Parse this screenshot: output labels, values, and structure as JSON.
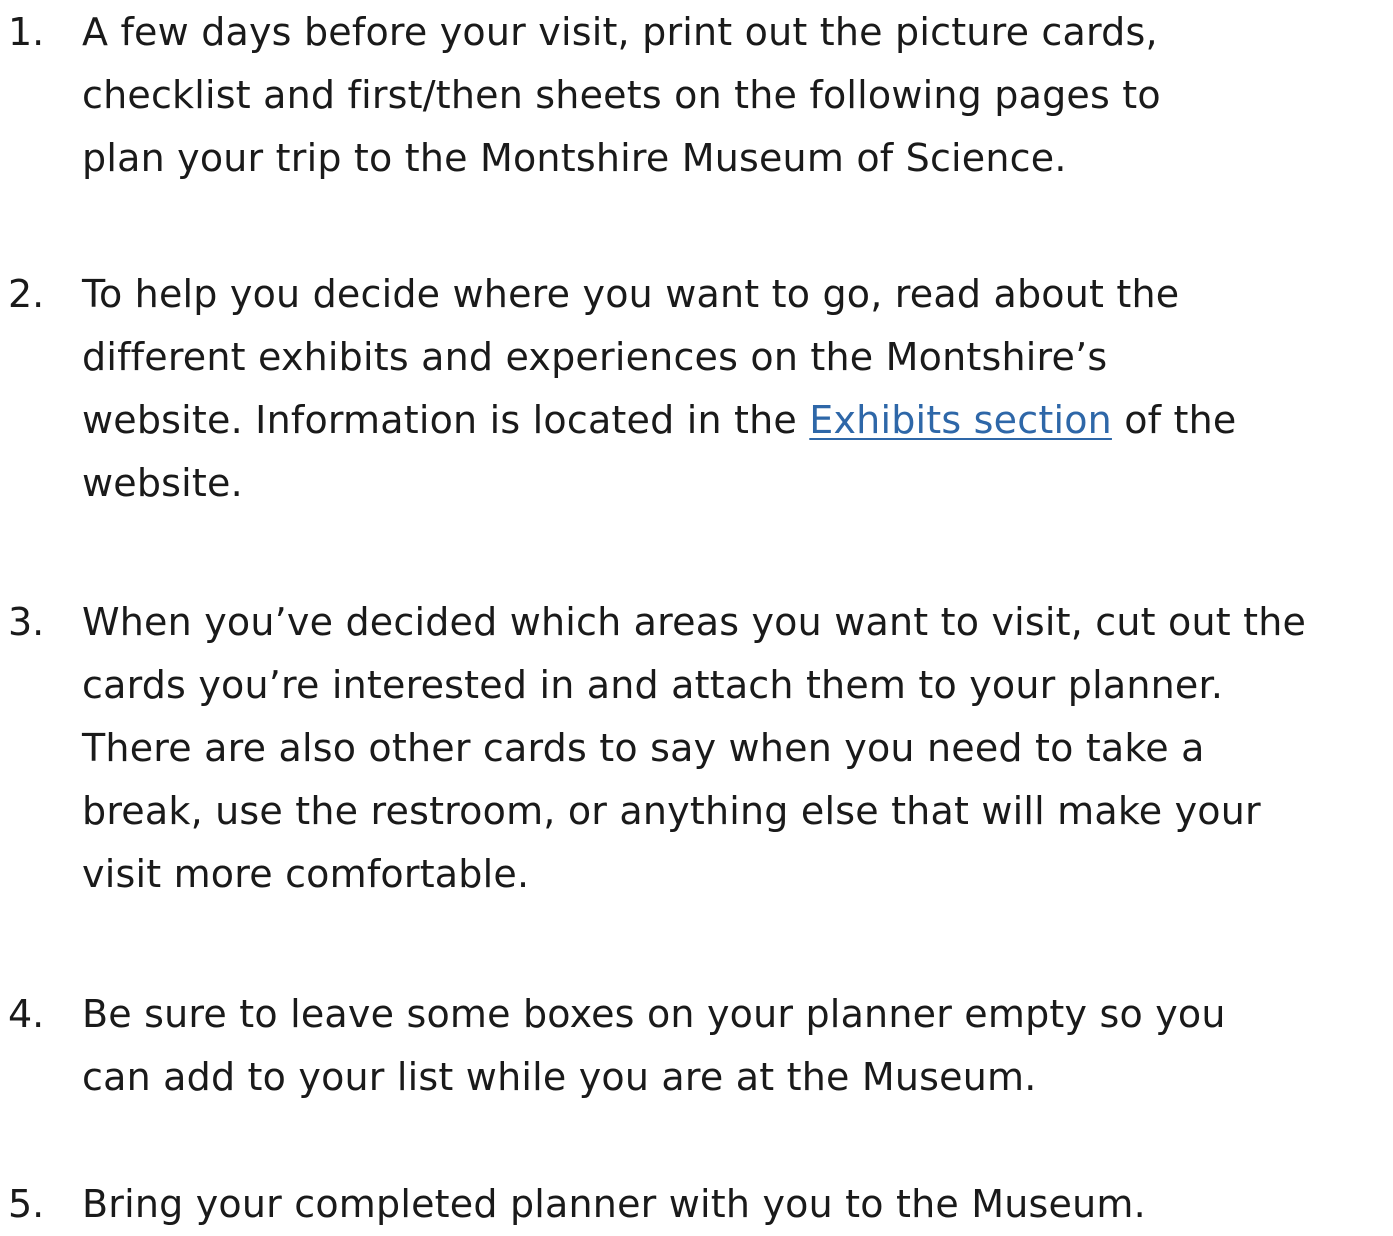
{
  "steps": [
    {
      "number": "1.",
      "lines": [
        "A few days before your visit, print out the picture cards,",
        "checklist and first/then sheets on the following pages to",
        "plan your trip to the Montshire Museum of Science."
      ]
    },
    {
      "number": "2.",
      "lines": [
        "To help you decide where you want to go, read about the",
        "different exhibits and experiences on the Montshire’s"
      ],
      "link_line": {
        "before": "website. Information is located in the ",
        "link": "Exhibits section",
        "after": " of the"
      },
      "last_line": "website."
    },
    {
      "number": "3.",
      "lines": [
        "When you’ve decided which areas you want to visit, cut out the",
        "cards you’re interested in and attach them to your planner.",
        "There are also other cards to say when you need to take a",
        "break, use the restroom, or anything else that will make your",
        "visit more comfortable."
      ]
    },
    {
      "number": "4.",
      "lines": [
        "Be sure to leave some boxes on your planner empty so you",
        "can add to your list while you are at the Museum."
      ]
    },
    {
      "number": "5.",
      "lines": [
        "Bring your completed planner with you to the Museum."
      ]
    }
  ]
}
